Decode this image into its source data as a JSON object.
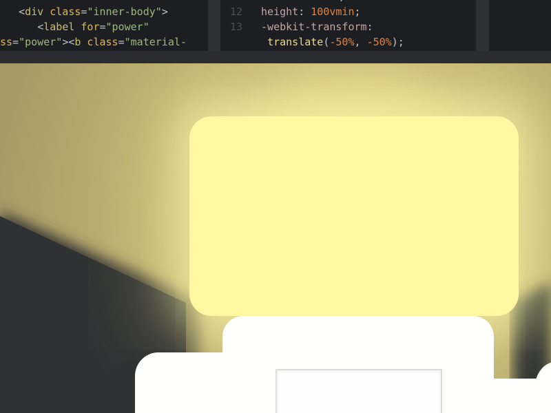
{
  "editor": {
    "html_pane": {
      "line1": {
        "indent": "   ",
        "open": "<",
        "tag": "div",
        "attr": " class",
        "eq": "=",
        "value": "\"inner-body\"",
        "close": ">"
      },
      "line2": {
        "indent": "      ",
        "open": "<",
        "tag": "label",
        "attr": " for",
        "eq": "=",
        "value": "\"power\""
      },
      "line3": {
        "prefix": "ss",
        "eq": "=",
        "value": "\"power\"",
        "close": ">",
        "open": "<",
        "tag": "b",
        "attr": " class",
        "eq2": "=",
        "value2": "\"material-"
      }
    },
    "css_pane": {
      "line0": {
        "text": "                   ;"
      },
      "line12": {
        "num": "12",
        "indent": " ",
        "prop": "height",
        "colon": ": ",
        "value": "100vmin",
        "semi": ";"
      },
      "line13": {
        "num": "13",
        "indent": " ",
        "prop": "-webkit-transform",
        "colon": ":"
      },
      "line14": {
        "indent": "  ",
        "fn": "translate",
        "open": "(",
        "v1": "-50%",
        "comma": ", ",
        "v2": "-50%",
        "close": ");"
      }
    }
  },
  "colors": {
    "screen_fill": "#fff8a2",
    "glow": "#d8cc7e",
    "backdrop": "#2f3133",
    "body": "#fffffd",
    "panel_border": "#dcdcda"
  }
}
